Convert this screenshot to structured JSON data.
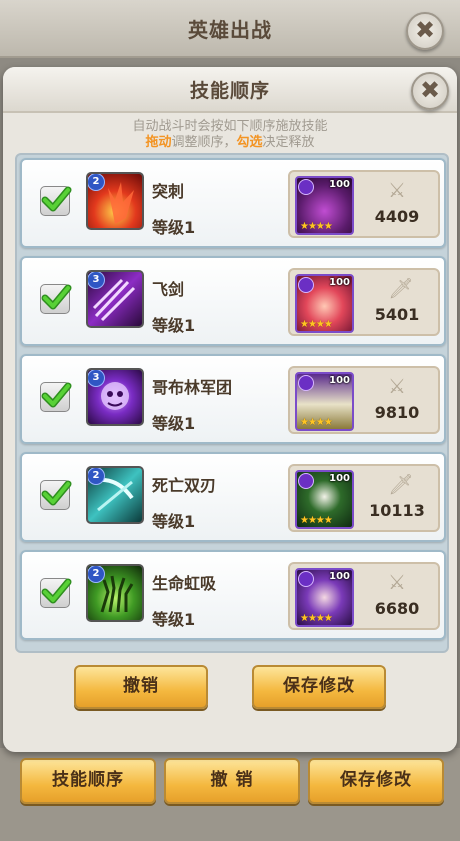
{
  "background_screen": {
    "title": "英雄出战",
    "close_symbol": "✖",
    "footer_buttons": [
      "技能顺序",
      "撤 销",
      "保存修改"
    ]
  },
  "modal": {
    "title": "技能顺序",
    "close_symbol": "✖",
    "hint_line1": "自动战斗时会按如下顺序施放技能",
    "hint_line2": {
      "part1": "拖动",
      "part2": "调整顺序，",
      "part3": "勾选",
      "part4": "决定释放"
    },
    "skills": [
      {
        "name": "突刺",
        "level_text": "等级1",
        "skill_badge": "2",
        "checked": true,
        "hero_level": "100",
        "stars": "★★★★",
        "power": "4409",
        "power_icon": "crossed-swords-icon",
        "icon_color": "#d8281a"
      },
      {
        "name": "飞剑",
        "level_text": "等级1",
        "skill_badge": "3",
        "checked": true,
        "hero_level": "100",
        "stars": "★★★★",
        "power": "5401",
        "power_icon": "sword-icon",
        "icon_color": "#6b1c8c"
      },
      {
        "name": "哥布林军团",
        "level_text": "等级1",
        "skill_badge": "3",
        "checked": true,
        "hero_level": "100",
        "stars": "★★★★",
        "power": "9810",
        "power_icon": "crossed-swords-icon",
        "icon_color": "#7a2cc4"
      },
      {
        "name": "死亡双刃",
        "level_text": "等级1",
        "skill_badge": "2",
        "checked": true,
        "hero_level": "100",
        "stars": "★★★★",
        "power": "10113",
        "power_icon": "sword-icon",
        "icon_color": "#1d8c8a"
      },
      {
        "name": "生命虹吸",
        "level_text": "等级1",
        "skill_badge": "2",
        "checked": true,
        "hero_level": "100",
        "stars": "★★★★",
        "power": "6680",
        "power_icon": "crossed-swords-icon",
        "icon_color": "#3f9a24"
      }
    ],
    "buttons": {
      "undo": "撤销",
      "save": "保存修改"
    }
  }
}
